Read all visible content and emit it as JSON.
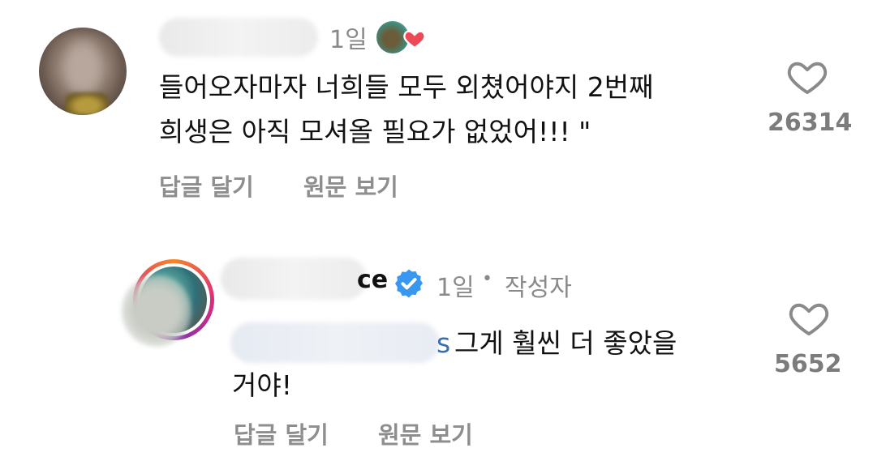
{
  "comments": [
    {
      "time": "1일",
      "text_lines": [
        "들어오자마자 너희들 모두 외쳤어야지 2번째",
        "희생은 아직 모셔올 필요가 없었어!!! \""
      ],
      "actions": {
        "reply": "답글 달기",
        "see_original": "원문 보기"
      },
      "like_count": "26314"
    },
    {
      "name_suffix": "ce",
      "time": "1일",
      "separator": "•",
      "author_tag": "작성자",
      "mention_suffix": "s",
      "text_lines": [
        "그게 훨씬 더 좋았을",
        "거야!"
      ],
      "actions": {
        "reply": "답글 달기",
        "see_original": "원문 보기"
      },
      "like_count": "5652"
    }
  ],
  "icons": {
    "like": "heart-outline-icon",
    "liked_by_author": "heart-filled-icon",
    "verified": "verified-badge-icon"
  },
  "colors": {
    "liked_heart": "#ed4956",
    "verified_blue": "#3897f0",
    "mention_blue": "#3b6bb3"
  }
}
